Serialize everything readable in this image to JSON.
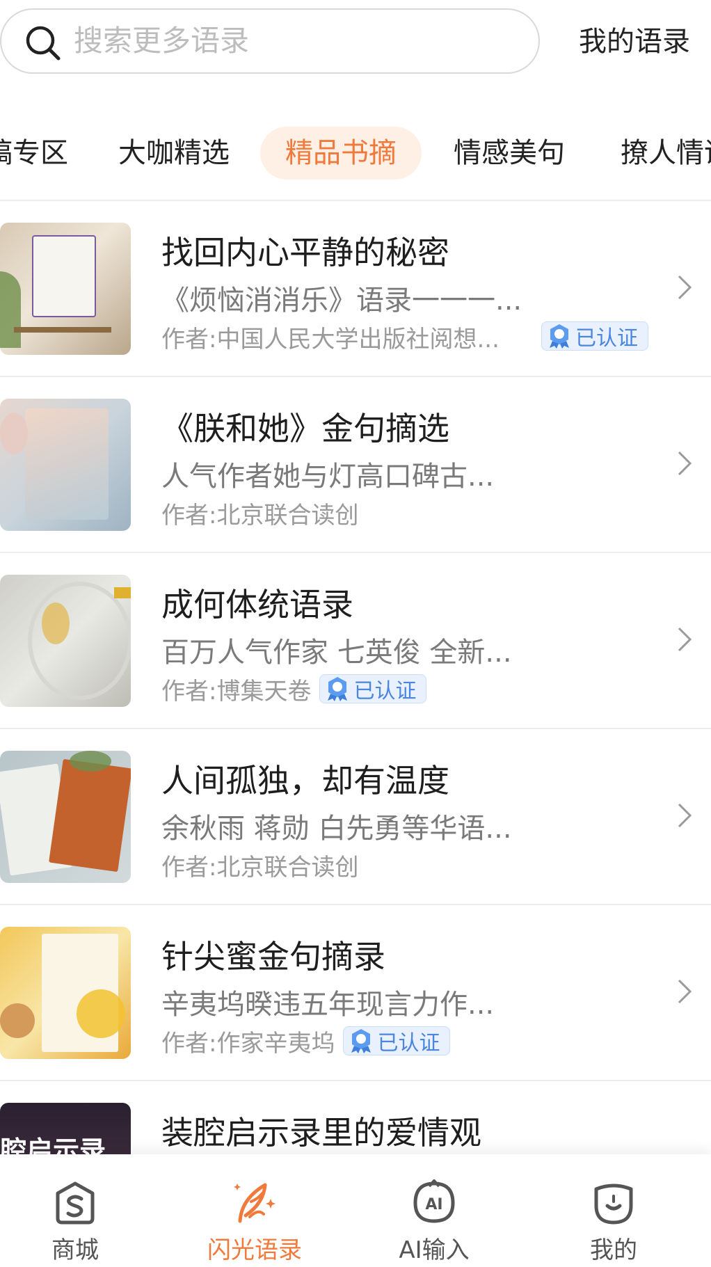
{
  "search": {
    "placeholder": "搜索更多语录"
  },
  "header": {
    "my_quotes_label": "我的语录"
  },
  "tabs": [
    {
      "label": "稿专区"
    },
    {
      "label": "大咖精选"
    },
    {
      "label": "精品书摘",
      "active": true
    },
    {
      "label": "情感美句"
    },
    {
      "label": "撩人情话"
    }
  ],
  "items": [
    {
      "title": "找回内心平静的秘密",
      "subtitle": "《烦恼消消乐》语录一一一...",
      "author": "作者:中国人民大学出版社阅想...",
      "verified": true,
      "verified_label": "已认证"
    },
    {
      "title": "《朕和她》金句摘选",
      "subtitle": " 人气作者她与灯高口碑古...",
      "author": "作者:北京联合读创",
      "verified": false
    },
    {
      "title": "成何体统语录",
      "subtitle": "百万人气作家 七英俊 全新...",
      "author": "作者:博集天卷",
      "verified": true,
      "verified_label": "已认证"
    },
    {
      "title": "人间孤独，却有温度",
      "subtitle": "余秋雨 蒋勋 白先勇等华语...",
      "author": "作者:北京联合读创",
      "verified": false
    },
    {
      "title": "针尖蜜金句摘录",
      "subtitle": "辛夷坞暌违五年现言力作...",
      "author": "作者:作家辛夷坞",
      "verified": true,
      "verified_label": "已认证"
    },
    {
      "title": "装腔启示录里的爱情观",
      "cover_text": "腔启示录"
    }
  ],
  "nav": [
    {
      "label": "商城",
      "icon": "shop-icon"
    },
    {
      "label": "闪光语录",
      "icon": "quote-feather-icon",
      "active": true
    },
    {
      "label": "AI输入",
      "icon": "ai-input-icon"
    },
    {
      "label": "我的",
      "icon": "profile-icon"
    }
  ],
  "colors": {
    "accent": "#f07a3c",
    "active_tab_bg": "#fff0e6",
    "badge_blue": "#4a86e0"
  }
}
